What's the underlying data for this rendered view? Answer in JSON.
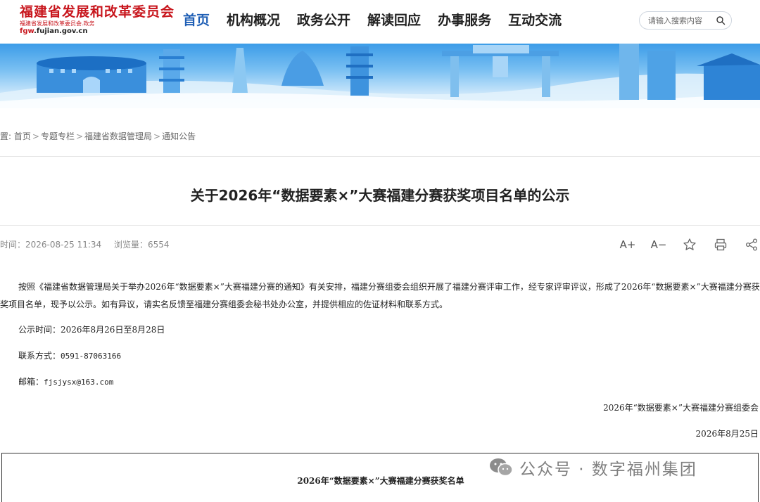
{
  "header": {
    "logo_name": "福建省发展和改革委员会",
    "logo_sub": "福建省发展和改革委员会.政务",
    "logo_domain_prefix": "fgw",
    "logo_domain_rest": ".fujian.gov.cn",
    "nav": [
      "首页",
      "机构概况",
      "政务公开",
      "解读回应",
      "办事服务",
      "互动交流"
    ],
    "search_placeholder": "请输入搜索内容"
  },
  "breadcrumb": {
    "prefix": "置:",
    "items": [
      "首页",
      "专题专栏",
      "福建省数据管理局",
      "通知公告"
    ],
    "separator": ">"
  },
  "article": {
    "title": "关于2026年“数据要素×”大赛福建分赛获奖项目名单的公示",
    "time_label": "时间：",
    "time_value": "2026-08-25 11:34",
    "views_label": "浏览量：",
    "views_value": "6554",
    "body": "按照《福建省数据管理局关于举办2026年“数据要素×”大赛福建分赛的通知》有关安排，福建分赛组委会组织开展了福建分赛评审工作，经专家评审评议，形成了2026年“数据要素×”大赛福建分赛获奖项目名单，现予以公示。如有异议，请实名反馈至福建分赛组委会秘书处办公室，并提供相应的佐证材料和联系方式。",
    "notice_period": "公示时间：2026年8月26日至8月28日",
    "contact_label": "联系方式：",
    "contact_value": "0591-87063166",
    "email_label": "邮箱：",
    "email_value": "fjsjysx@163.com",
    "signature": "2026年“数据要素×”大赛福建分赛组委会",
    "date": "2026年8月25日",
    "table_title": "2026年“数据要素×”大赛福建分赛获奖名单"
  },
  "tools": {
    "font_larger": "A+",
    "font_smaller": "A−"
  },
  "watermark": {
    "text": "公众号 · 数字福州集团"
  },
  "colors": {
    "brand_red": "#c8161d",
    "nav_active": "#1f5fb5",
    "banner_blue": "#3c9ce8"
  }
}
